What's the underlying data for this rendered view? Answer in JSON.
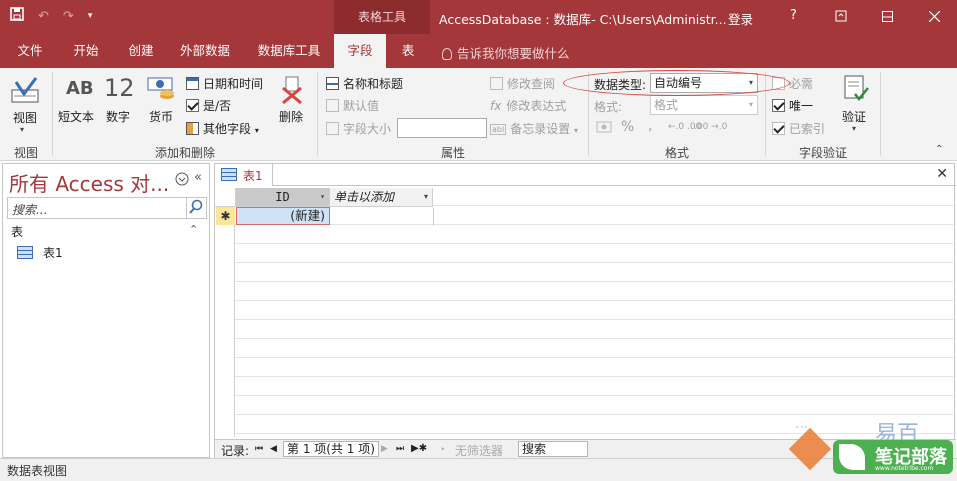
{
  "title_bar": {
    "context_tab": "表格工具",
    "window_title": "AccessDatabase : 数据库- C:\\Users\\Administr...",
    "login": "登录",
    "help": "?",
    "quick_access": [
      "save-icon",
      "undo-icon",
      "redo-icon",
      "customize-icon"
    ]
  },
  "ribbon_tabs": [
    {
      "label": "文件"
    },
    {
      "label": "开始"
    },
    {
      "label": "创建"
    },
    {
      "label": "外部数据"
    },
    {
      "label": "数据库工具"
    },
    {
      "label": "字段",
      "active": true
    },
    {
      "label": "表"
    }
  ],
  "tell_me": "告诉我你想要做什么",
  "ribbon": {
    "view": {
      "label": "视图",
      "group": "视图"
    },
    "add_delete": {
      "group": "添加和删除",
      "short_text": "短文本",
      "number": "数字",
      "number_glyph": "12",
      "short_text_glyph": "AB",
      "currency": "货币",
      "date_time": "日期和时间",
      "yes_no": "是/否",
      "more_fields": "其他字段",
      "delete": "删除"
    },
    "properties": {
      "group": "属性",
      "name_caption": "名称和标题",
      "default_value": "默认值",
      "field_size": "字段大小",
      "modify_lookups": "修改查阅",
      "modify_expression": "修改表达式",
      "memo_settings": "备忘录设置"
    },
    "formatting": {
      "group": "格式",
      "data_type_label": "数据类型:",
      "data_type_value": "自动编号",
      "format_label": "格式:",
      "format_value": "格式",
      "percent": "%",
      "comma": ",",
      "inc_decimals": "←.0 .00",
      "dec_decimals": ".00 →.0"
    },
    "validation": {
      "group": "字段验证",
      "required": "必需",
      "unique": "唯一",
      "indexed": "已索引",
      "validation": "验证"
    }
  },
  "nav_pane": {
    "title": "所有 Access 对...",
    "search_placeholder": "搜索...",
    "section": "表",
    "items": [
      {
        "label": "表1"
      }
    ]
  },
  "document": {
    "tab": "表1",
    "columns": [
      {
        "label": "ID"
      },
      {
        "label": "单击以添加"
      }
    ],
    "new_row_label": "(新建)",
    "record_nav": {
      "label": "记录:",
      "position": "第 1 项(共 1 项)",
      "filter": "无筛选器",
      "search": "搜索"
    }
  },
  "status_bar": "数据表视图",
  "watermark": {
    "text": "笔记部落",
    "url": "www.notetribe.com",
    "brand": "易百"
  }
}
